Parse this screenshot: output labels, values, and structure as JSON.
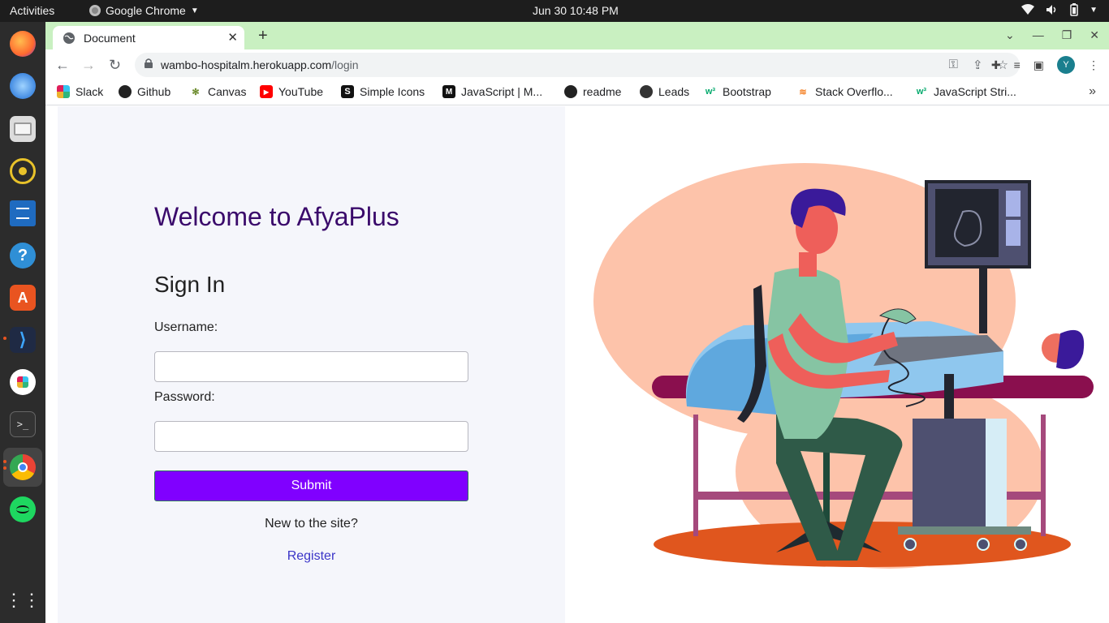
{
  "desktop": {
    "activities": "Activities",
    "app_name": "Google Chrome",
    "clock": "Jun 30  10:48 PM"
  },
  "browser": {
    "tab_title": "Document",
    "url_host": "wambo-hospitalm.herokuapp.com",
    "url_path": "/login",
    "profile_initial": "Y",
    "bookmarks": [
      {
        "label": "Slack",
        "icon": "slack-icon"
      },
      {
        "label": "Github",
        "icon": "github-icon"
      },
      {
        "label": "Canvas",
        "icon": "canvas-icon"
      },
      {
        "label": "YouTube",
        "icon": "youtube-icon"
      },
      {
        "label": "Simple Icons",
        "icon": "simple-icons-icon"
      },
      {
        "label": "JavaScript | M...",
        "icon": "mdn-icon"
      },
      {
        "label": "readme",
        "icon": "github-icon"
      },
      {
        "label": "Leads",
        "icon": "globe-icon"
      },
      {
        "label": "Bootstrap",
        "icon": "w3schools-icon"
      },
      {
        "label": "Stack Overflo...",
        "icon": "stackoverflow-icon"
      },
      {
        "label": "JavaScript Stri...",
        "icon": "w3schools-icon"
      }
    ]
  },
  "page": {
    "welcome": "Welcome to AfyaPlus",
    "heading": "Sign In",
    "username_label": "Username:",
    "username_value": "",
    "password_label": "Password:",
    "password_value": "",
    "submit_label": "Submit",
    "new_to_site": "New to the site?",
    "register_label": "Register"
  },
  "colors": {
    "tabstrip": "#c9f0c1",
    "welcome": "#3a0a6b",
    "submit": "#8000ff",
    "register_link": "#3b35c8",
    "left_panel": "#f5f6fb"
  }
}
